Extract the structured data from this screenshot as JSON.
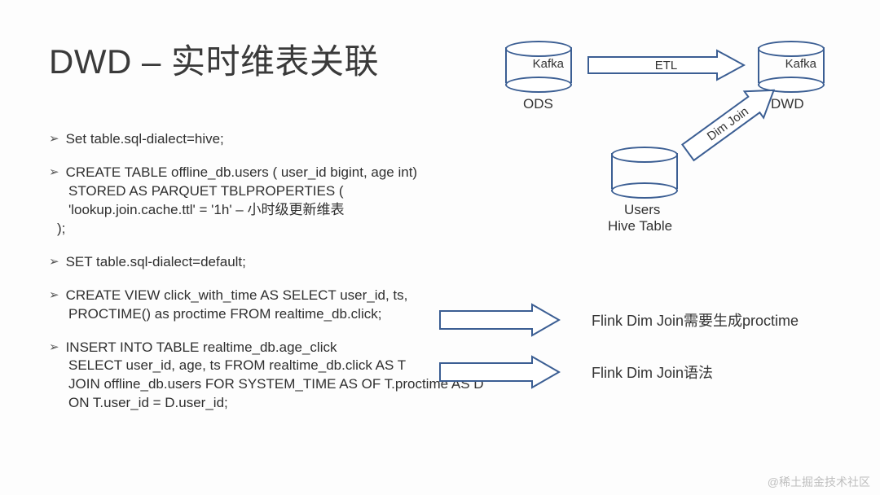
{
  "title": "DWD – 实时维表关联",
  "bullets": {
    "b1": "Set table.sql-dialect=hive;",
    "b2": {
      "l1": "CREATE TABLE offline_db.users ( user_id bigint, age int)",
      "l2": "STORED AS PARQUET TBLPROPERTIES (",
      "l3": "'lookup.join.cache.ttl' = '1h' – 小时级更新维表",
      "l4": ");"
    },
    "b3": "SET table.sql-dialect=default;",
    "b4": {
      "l1": "CREATE VIEW click_with_time AS SELECT user_id, ts,",
      "l2": "PROCTIME() as proctime FROM realtime_db.click;"
    },
    "b5": {
      "l1": "INSERT INTO TABLE realtime_db.age_click",
      "l2": "SELECT user_id, age, ts FROM realtime_db.click AS T",
      "l3": "JOIN offline_db.users FOR SYSTEM_TIME AS OF T.proctime AS D",
      "l4": "ON T.user_id = D.user_id;"
    }
  },
  "diagram": {
    "ods_cyl": "Kafka",
    "ods_label": "ODS",
    "dwd_cyl": "Kafka",
    "dwd_label": "DWD",
    "etl_arrow": "ETL",
    "dim_arrow": "Dim Join",
    "users_line1": "Users",
    "users_line2": "Hive Table"
  },
  "annotations": {
    "a1": "Flink Dim Join需要生成proctime",
    "a2": "Flink Dim Join语法"
  },
  "watermark": "@稀土掘金技术社区"
}
